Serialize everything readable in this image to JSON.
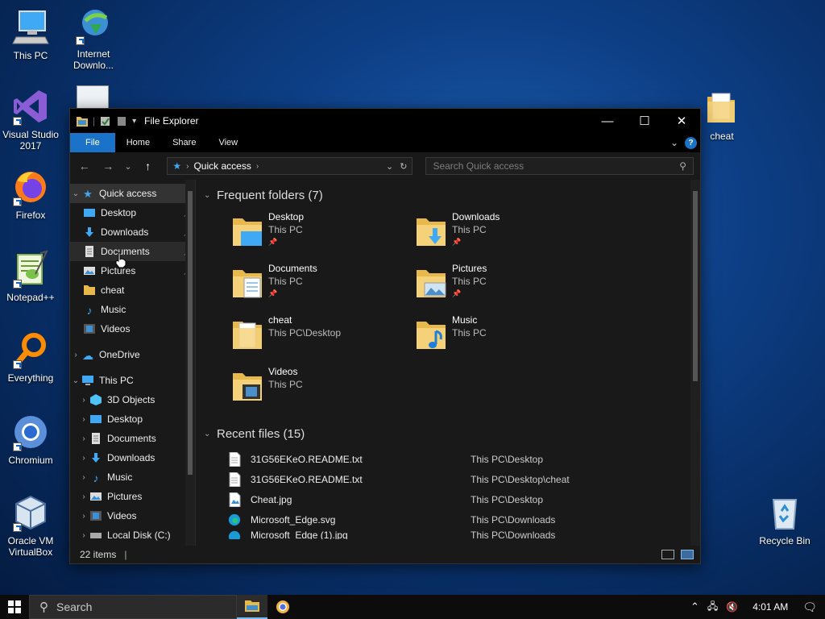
{
  "desktop": {
    "icons_left": [
      {
        "label": "This PC",
        "icon": "this-pc-icon"
      },
      {
        "label": "Visual Studio 2017",
        "icon": "visual-studio-icon"
      },
      {
        "label": "Firefox",
        "icon": "firefox-icon"
      },
      {
        "label": "Notepad++",
        "icon": "notepad-plus-plus-icon"
      },
      {
        "label": "Everything",
        "icon": "everything-search-icon"
      },
      {
        "label": "Chromium",
        "icon": "chromium-icon"
      },
      {
        "label": "Oracle VM VirtualBox",
        "icon": "virtualbox-icon"
      }
    ],
    "icon_internet": {
      "label": "Internet Downlo...",
      "icon": "internet-download-manager-icon"
    },
    "icon_cheat": {
      "label": "cheat",
      "icon": "folder-icon"
    },
    "icon_recycle": {
      "label": "Recycle Bin",
      "icon": "recycle-bin-icon"
    }
  },
  "window": {
    "title": "File Explorer",
    "controls": {
      "minimize": "—",
      "maximize": "☐",
      "close": "✕"
    },
    "ribbon": {
      "tabs": [
        "File",
        "Home",
        "Share",
        "View"
      ],
      "help": "?"
    },
    "nav": {
      "back": "←",
      "forward": "→",
      "recent": "⌄",
      "up": "↑"
    },
    "address": {
      "location": "Quick access"
    },
    "search": {
      "placeholder": "Search Quick access"
    },
    "navpane": {
      "quick_access": {
        "label": "Quick access"
      },
      "quick_items": [
        {
          "label": "Desktop",
          "icon": "desktop-folder-icon",
          "pinned": true
        },
        {
          "label": "Downloads",
          "icon": "downloads-folder-icon",
          "pinned": true
        },
        {
          "label": "Documents",
          "icon": "documents-folder-icon",
          "pinned": true
        },
        {
          "label": "Pictures",
          "icon": "pictures-folder-icon",
          "pinned": true
        },
        {
          "label": "cheat",
          "icon": "folder-icon",
          "pinned": false
        },
        {
          "label": "Music",
          "icon": "music-folder-icon",
          "pinned": false
        },
        {
          "label": "Videos",
          "icon": "videos-folder-icon",
          "pinned": false
        }
      ],
      "onedrive": {
        "label": "OneDrive"
      },
      "this_pc": {
        "label": "This PC"
      },
      "pc_items": [
        {
          "label": "3D Objects",
          "icon": "3d-objects-icon"
        },
        {
          "label": "Desktop",
          "icon": "desktop-folder-icon"
        },
        {
          "label": "Documents",
          "icon": "documents-folder-icon"
        },
        {
          "label": "Downloads",
          "icon": "downloads-folder-icon"
        },
        {
          "label": "Music",
          "icon": "music-folder-icon"
        },
        {
          "label": "Pictures",
          "icon": "pictures-folder-icon"
        },
        {
          "label": "Videos",
          "icon": "videos-folder-icon"
        },
        {
          "label": "Local Disk (C:)",
          "icon": "drive-icon"
        }
      ]
    },
    "frequent": {
      "header": "Frequent folders (7)",
      "folders": [
        {
          "name": "Desktop",
          "path": "This PC",
          "pinned": true,
          "icon": "desktop-folder-icon"
        },
        {
          "name": "Downloads",
          "path": "This PC",
          "pinned": true,
          "icon": "downloads-folder-icon"
        },
        {
          "name": "Documents",
          "path": "This PC",
          "pinned": true,
          "icon": "documents-folder-icon"
        },
        {
          "name": "Pictures",
          "path": "This PC",
          "pinned": true,
          "icon": "pictures-folder-icon"
        },
        {
          "name": "cheat",
          "path": "This PC\\Desktop",
          "pinned": false,
          "icon": "folder-icon"
        },
        {
          "name": "Music",
          "path": "This PC",
          "pinned": false,
          "icon": "music-folder-icon"
        },
        {
          "name": "Videos",
          "path": "This PC",
          "pinned": false,
          "icon": "videos-folder-icon"
        }
      ]
    },
    "recent": {
      "header": "Recent files (15)",
      "files": [
        {
          "name": "31G56EKeO.README.txt",
          "path": "This PC\\Desktop",
          "icon": "text-file-icon"
        },
        {
          "name": "31G56EKeO.README.txt",
          "path": "This PC\\Desktop\\cheat",
          "icon": "text-file-icon"
        },
        {
          "name": "Cheat.jpg",
          "path": "This PC\\Desktop",
          "icon": "image-file-icon"
        },
        {
          "name": "Microsoft_Edge.svg",
          "path": "This PC\\Downloads",
          "icon": "edge-file-icon"
        },
        {
          "name": "Microsoft_Edge (1).jpg",
          "path": "This PC\\Downloads",
          "icon": "edge-file-icon"
        }
      ]
    },
    "status": {
      "items": "22 items"
    }
  },
  "taskbar": {
    "search_placeholder": "Search",
    "clock": "4:01 AM"
  },
  "colors": {
    "accent": "#1a73c8",
    "folder": "#f0c65a",
    "window_bg": "#191919"
  }
}
